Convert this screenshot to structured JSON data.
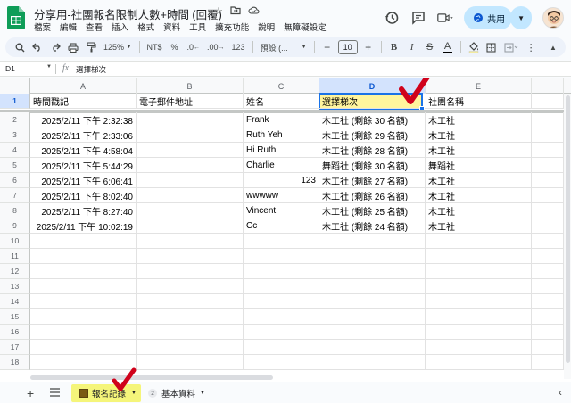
{
  "header": {
    "title": "分享用-社團報名限制人數+時間 (回覆)",
    "menu": [
      "檔案",
      "編輯",
      "查看",
      "插入",
      "格式",
      "資料",
      "工具",
      "擴充功能",
      "說明",
      "無障礙設定"
    ],
    "share_label": "共用",
    "icons": [
      "star-icon",
      "move-folder-icon",
      "cloud-status-icon",
      "history-icon",
      "comments-icon",
      "meet-icon"
    ]
  },
  "toolbar": {
    "zoom": "125%",
    "currency": "NT$",
    "percent": "%",
    "decimal_decrease": ".0",
    "decimal_increase": ".00",
    "number_format": "123",
    "font": "預設 (...",
    "font_size": "10",
    "bold": "B",
    "italic": "I",
    "strike": "S",
    "text_color": "A"
  },
  "formula_bar": {
    "cell_ref": "D1",
    "fx": "fx",
    "value": "選擇梯次"
  },
  "grid": {
    "columns": [
      "A",
      "B",
      "C",
      "D",
      "E"
    ],
    "selected_column": "D",
    "headers": [
      "時間戳記",
      "電子郵件地址",
      "姓名",
      "選擇梯次",
      "社團名稱"
    ],
    "rows": [
      [
        "2025/2/11 下午 2:32:38",
        "",
        "Frank",
        "木工社 (剩餘 30 名額)",
        "木工社"
      ],
      [
        "2025/2/11 下午 2:33:06",
        "",
        "Ruth Yeh",
        "木工社 (剩餘 29 名額)",
        "木工社"
      ],
      [
        "2025/2/11 下午 4:58:04",
        "",
        "Hi Ruth",
        "木工社 (剩餘 28 名額)",
        "木工社"
      ],
      [
        "2025/2/11 下午 5:44:29",
        "",
        "Charlie",
        "舞蹈社 (剩餘 30 名額)",
        "舞蹈社"
      ],
      [
        "2025/2/11 下午 6:06:41",
        "",
        "123",
        "木工社 (剩餘 27 名額)",
        "木工社"
      ],
      [
        "2025/2/11 下午 8:02:40",
        "",
        "wwwww",
        "木工社 (剩餘 26 名額)",
        "木工社"
      ],
      [
        "2025/2/11 下午 8:27:40",
        "",
        "Vincent",
        "木工社 (剩餘 25 名額)",
        "木工社"
      ],
      [
        "2025/2/11 下午 10:02:19",
        "",
        "Cc",
        "木工社 (剩餘 24 名額)",
        "木工社"
      ]
    ],
    "row_numbers": [
      "1",
      "2",
      "3",
      "4",
      "5",
      "6",
      "7",
      "8",
      "9",
      "10",
      "11",
      "12",
      "13",
      "14",
      "15",
      "16",
      "17",
      "18"
    ]
  },
  "sheets": {
    "active": "報名記錄",
    "other": "基本資料",
    "other_badge": "2"
  },
  "colors": {
    "accent": "#1a73e8",
    "highlight": "#fff59d",
    "tab_highlight": "#f5f57a",
    "check": "#d0021b"
  }
}
